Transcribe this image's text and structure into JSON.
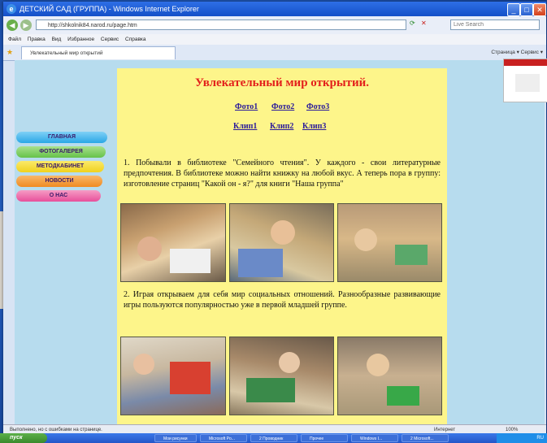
{
  "window": {
    "title": "ДЕТСКИЙ САД (ГРУППА) - Windows Internet Explorer",
    "address": "http://shkolnik84.narod.ru/page.htm",
    "search_placeholder": "Live Search",
    "tab_label": "Увлекательный мир открытий",
    "menu": [
      "Файл",
      "Правка",
      "Вид",
      "Избранное",
      "Сервис",
      "Справка"
    ],
    "commands": "Страница ▾  Сервис ▾"
  },
  "page": {
    "title": "Увлекательный мир открытий.",
    "photo_links": [
      "Фото1",
      "Фото2",
      "Фото3"
    ],
    "clip_links": [
      "Клип1",
      "Клип2",
      "Клип3"
    ],
    "paragraph1": "1. Побывали в библиотеке \"Семейного чтения\". У каждого - свои литературные предпочтения. В библиотеке можно найти книжку на любой вкус. А теперь пора в группу: изготовление страниц \"Какой он - я?\" для книги \"Наша группа\"",
    "paragraph2": "2. Играя открываем для себя мир социальных отношений. Разнообразные развивающие игры пользуются популярностью уже в первой младшей группе."
  },
  "sidebar": {
    "items": [
      {
        "label": "ГЛАВНАЯ",
        "color": "#2aa7e6"
      },
      {
        "label": "ФОТОГАЛЕРЕЯ",
        "color": "#66c24a"
      },
      {
        "label": "МЕТОДКАБИНЕТ",
        "color": "#f0d21e"
      },
      {
        "label": "НОВОСТИ",
        "color": "#f08a22"
      },
      {
        "label": "О НАС",
        "color": "#e8509a"
      }
    ]
  },
  "status": {
    "text": "Выполнено, но с ошибками на странице.",
    "zone": "Интернет",
    "zoom": "100%"
  },
  "taskbar": {
    "start": "пуск",
    "tasks": [
      "Мои рисунки",
      "Microsoft Po...",
      "2 Проводник",
      "Прочее",
      "Windows I...",
      "2 Microsoft..."
    ],
    "clock": "RU"
  }
}
